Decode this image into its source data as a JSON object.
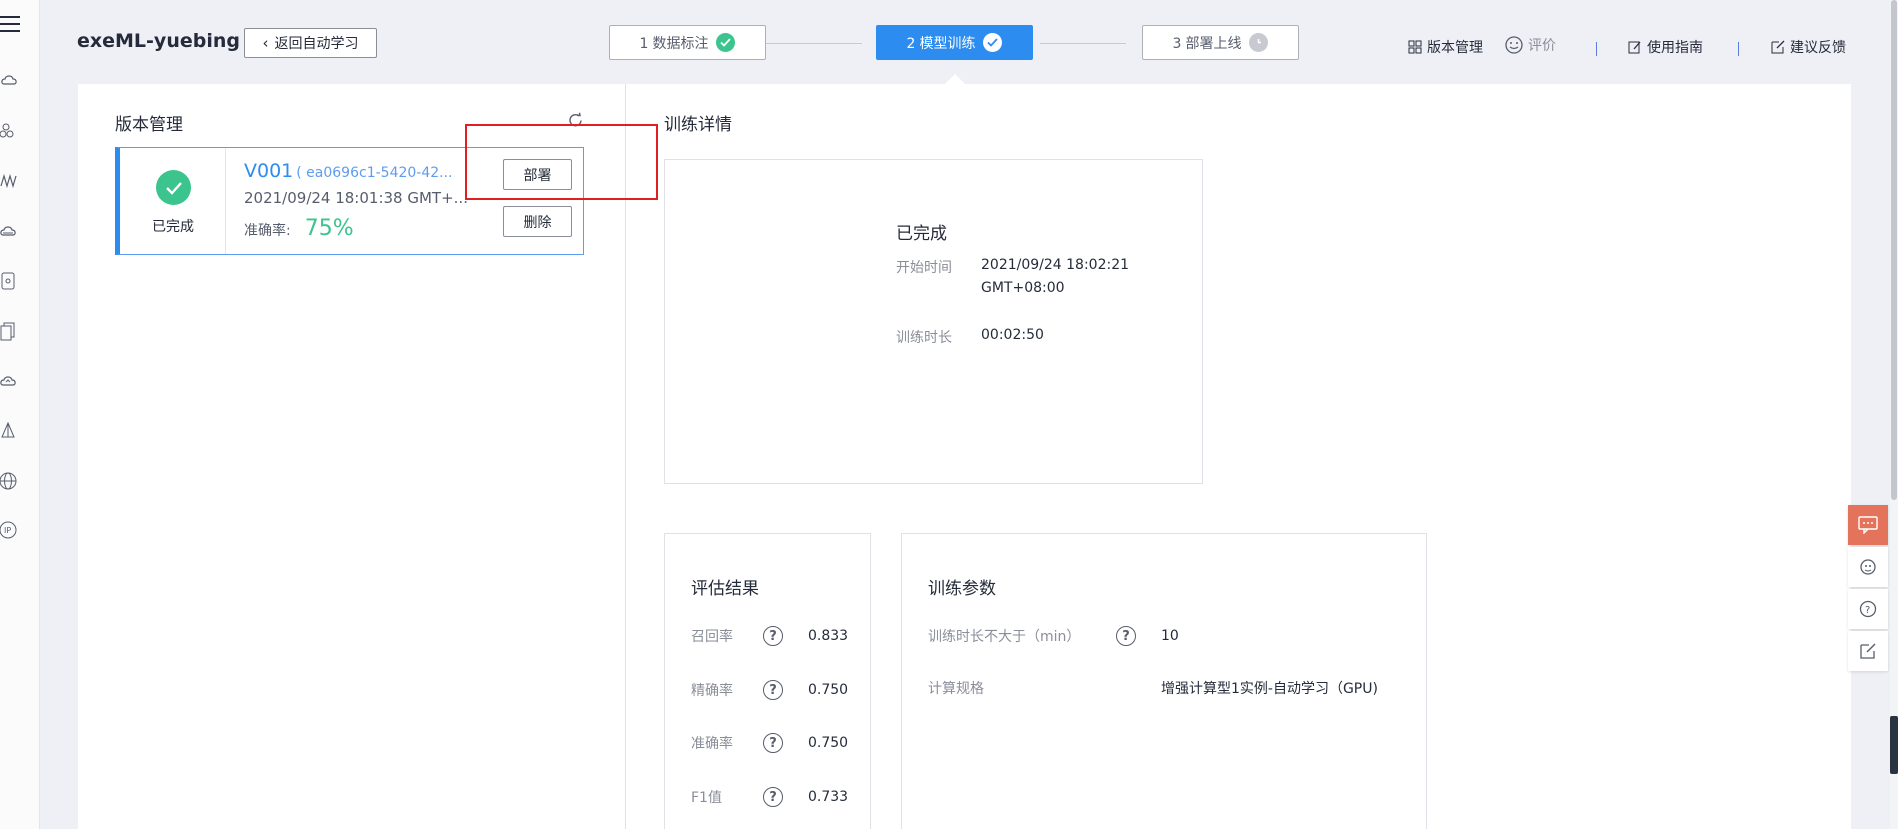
{
  "header": {
    "app_title": "exeML-yuebing",
    "back_label": "返回自动学习"
  },
  "steps": [
    {
      "num": "1",
      "label": "数据标注",
      "state": "done"
    },
    {
      "num": "2",
      "label": "模型训练",
      "state": "active"
    },
    {
      "num": "3",
      "label": "部署上线",
      "state": "pending"
    }
  ],
  "top_links": {
    "version_mgmt": "版本管理",
    "rate": "评价",
    "guide": "使用指南",
    "feedback": "建议反馈"
  },
  "version_panel": {
    "title": "版本管理",
    "card": {
      "status": "已完成",
      "version": "V001",
      "version_id": "( ea0696c1-5420-42...",
      "time": "2021/09/24 18:01:38 GMT+...",
      "accuracy_label": "准确率:",
      "accuracy_value": "75%",
      "deploy_label": "部署",
      "delete_label": "删除"
    }
  },
  "detail": {
    "title": "训练详情",
    "status": "已完成",
    "start_label": "开始时间",
    "start_value_line1": "2021/09/24 18:02:21",
    "start_value_line2": "GMT+08:00",
    "duration_label": "训练时长",
    "duration_value": "00:02:50"
  },
  "eval": {
    "title": "评估结果",
    "rows": [
      {
        "label": "召回率",
        "value": "0.833"
      },
      {
        "label": "精确率",
        "value": "0.750"
      },
      {
        "label": "准确率",
        "value": "0.750"
      },
      {
        "label": "F1值",
        "value": "0.733"
      }
    ]
  },
  "params": {
    "title": "训练参数",
    "max_duration_label": "训练时长不大于（min）",
    "max_duration_value": "10",
    "spec_label": "计算规格",
    "spec_value": "增强计算型1实例-自动学习（GPU)"
  },
  "colors": {
    "primary": "#2d8cf0",
    "success": "#3bc48d",
    "highlight": "#e02020",
    "feedback": "#e4735b"
  }
}
